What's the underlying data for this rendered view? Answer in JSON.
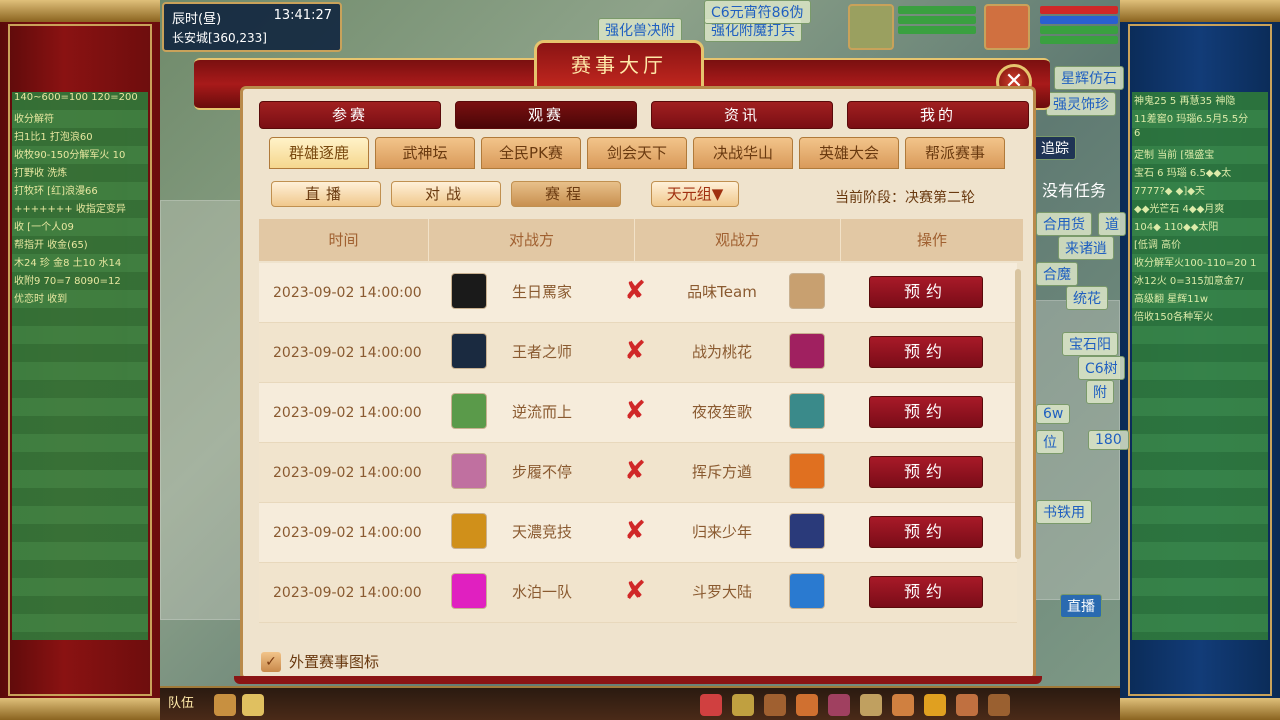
{
  "hud": {
    "clock_label": "辰时(昼)",
    "clock_time": "13:41:27",
    "location": "长安城[360,233]"
  },
  "world_labels": [
    "强化兽决附",
    "强化附魔打兵",
    "C6元宵符86伪",
    "星辉仿石",
    "强灵饰珍",
    "追踪",
    "没有任务",
    "合用货",
    "道",
    "来诸逍",
    "合魔",
    "统花",
    "宝石阳",
    "C6树",
    "附",
    "6w",
    "180",
    "位",
    "书铁用",
    "直播"
  ],
  "dialog": {
    "title": "赛事大厅",
    "close_icon": "✕",
    "main_tabs": [
      {
        "label": "参赛",
        "active": false
      },
      {
        "label": "观赛",
        "active": true
      },
      {
        "label": "资讯",
        "active": false
      },
      {
        "label": "我的",
        "active": false
      }
    ],
    "sub_tabs": [
      {
        "label": "群雄逐鹿",
        "active": true
      },
      {
        "label": "武神坛",
        "active": false
      },
      {
        "label": "全民PK赛",
        "active": false
      },
      {
        "label": "剑会天下",
        "active": false
      },
      {
        "label": "决战华山",
        "active": false
      },
      {
        "label": "英雄大会",
        "active": false
      },
      {
        "label": "帮派赛事",
        "active": false
      }
    ],
    "filters": [
      {
        "label": "直播",
        "active": false
      },
      {
        "label": "对战",
        "active": false
      },
      {
        "label": "赛程",
        "active": true
      }
    ],
    "group_select": "天元组▼",
    "stage_info": "当前阶段：决赛第二轮",
    "columns": [
      "时间",
      "对战方",
      "观战方",
      "操作"
    ],
    "reserve_label": "预约",
    "vs_icon": "✘",
    "rows": [
      {
        "time": "2023-09-02 14:00:00",
        "team_a": "生日罵家",
        "team_b": "品味Team",
        "logo_a": "#1a1a1a",
        "logo_b": "#c8a070"
      },
      {
        "time": "2023-09-02 14:00:00",
        "team_a": "王者之师",
        "team_b": "战为桃花",
        "logo_a": "#1a2a40",
        "logo_b": "#a02060"
      },
      {
        "time": "2023-09-02 14:00:00",
        "team_a": "逆流而上",
        "team_b": "夜夜笙歌",
        "logo_a": "#5a9a4a",
        "logo_b": "#3a8a8a"
      },
      {
        "time": "2023-09-02 14:00:00",
        "team_a": "步履不停",
        "team_b": "挥斥方遒",
        "logo_a": "#c070a0",
        "logo_b": "#e07020"
      },
      {
        "time": "2023-09-02 14:00:00",
        "team_a": "天濃竞技",
        "team_b": "归来少年",
        "logo_a": "#d0901a",
        "logo_b": "#2a3a7a"
      },
      {
        "time": "2023-09-02 14:00:00",
        "team_a": "水泊一队",
        "team_b": "斗罗大陆",
        "logo_a": "#e020c0",
        "logo_b": "#2a7ad0"
      }
    ],
    "footer_checkbox_label": "外置赛事图标",
    "footer_check_icon": "✓"
  },
  "toolbar": {
    "team_label": "队伍"
  },
  "side_chat_left": [
    "140~600=100 120=200",
    "收分解符",
    "扫1比1 打泡浪60",
    "收牧90-150分解军火 10",
    "打野收 洗炼",
    "打牧环 [红]浪漫66",
    "+++++++ 收指定变异",
    "收 [一个人09",
    "帮指开 收金(65)",
    "木24 珍 金8 土10 水14",
    "收附9 70=7 8090=12",
    "优恋时 收到"
  ],
  "side_chat_right": [
    "神鬼25 5 再慧35 神隐",
    "11差窖0 玛瑙6.5月5.5分",
    "6",
    "定制 当前 [强盛宝",
    "宝石 6 玛瑙 6.5◆◆太",
    "7777?◆ ◆]◆天",
    "◆◆光芒石 4◆◆月爽",
    "104◆ 110◆◆太阳",
    "[低调 高价",
    "收分解军火100-110=20 1",
    "冰12火 0=315加意金7/",
    "高级翻 星辉11w",
    "倍收150各种军火"
  ]
}
